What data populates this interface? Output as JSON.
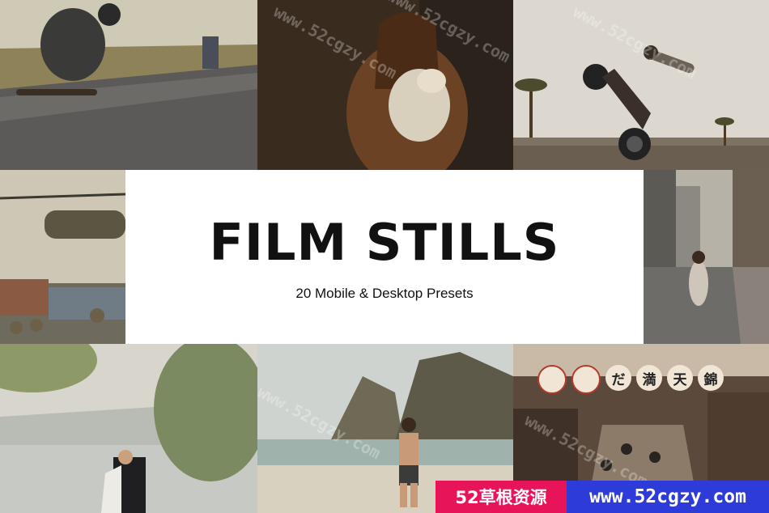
{
  "hero": {
    "title": "FILM STILLS",
    "subtitle": "20 Mobile & Desktop Presets"
  },
  "watermark": {
    "text": "www.52cgzy.com"
  },
  "banner": {
    "brand": "52草根资源",
    "url": "www.52cgzy.com",
    "brand_color": "#e8145a",
    "url_color": "#2d3bd8"
  },
  "shop_signs": [
    "だ",
    "満",
    "天",
    "錦"
  ],
  "colors": {
    "card_bg": "#ffffff",
    "title": "#111111"
  }
}
